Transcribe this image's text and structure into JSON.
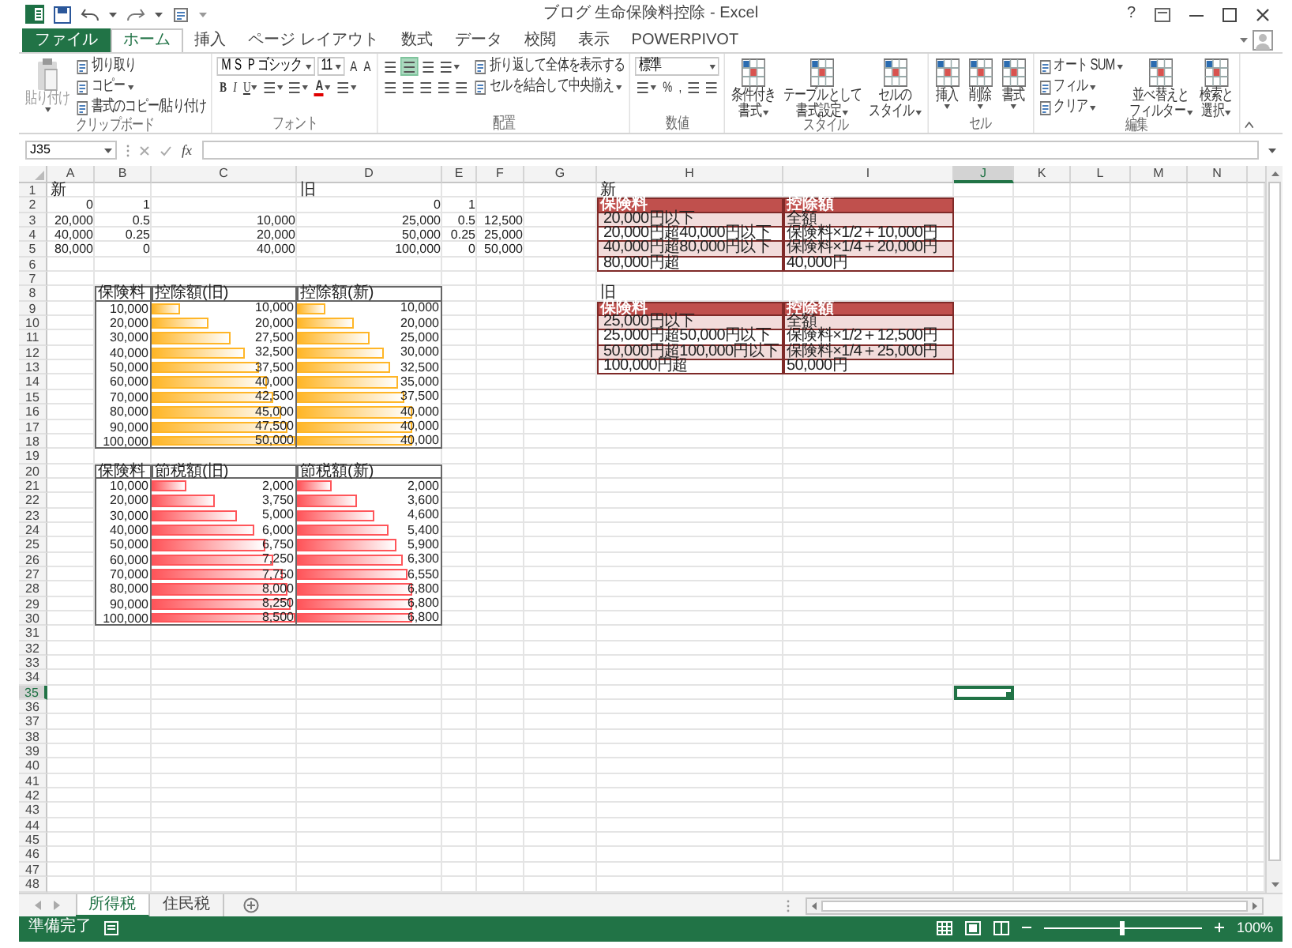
{
  "window": {
    "title": "ブログ 生命保険料控除 - Excel",
    "help": "?"
  },
  "ribbon_tabs": [
    {
      "label": "ファイル",
      "kind": "file",
      "selected": false
    },
    {
      "label": "ホーム",
      "kind": "tab",
      "selected": true
    },
    {
      "label": "挿入",
      "kind": "tab",
      "selected": false
    },
    {
      "label": "ページ レイアウト",
      "kind": "tab",
      "selected": false
    },
    {
      "label": "数式",
      "kind": "tab",
      "selected": false
    },
    {
      "label": "データ",
      "kind": "tab",
      "selected": false
    },
    {
      "label": "校閲",
      "kind": "tab",
      "selected": false
    },
    {
      "label": "表示",
      "kind": "tab",
      "selected": false
    },
    {
      "label": "POWERPIVOT",
      "kind": "tab",
      "selected": false
    }
  ],
  "ribbon_groups": [
    {
      "label": "クリップボード",
      "columns": [
        {
          "kind": "large",
          "lines": [
            "貼り付け"
          ],
          "disabled": true,
          "dropdown": true
        },
        {
          "kind": "stack",
          "rows": [
            {
              "controls": [
                {
                  "kind": "small",
                  "label": "切り取り"
                }
              ]
            },
            {
              "controls": [
                {
                  "kind": "small",
                  "label": "コピー",
                  "dropdown": true
                }
              ]
            },
            {
              "controls": [
                {
                  "kind": "small",
                  "label": "書式のコピー/貼り付け"
                }
              ]
            }
          ]
        }
      ]
    },
    {
      "label": "フォント",
      "columns": [
        {
          "kind": "stack",
          "rows": [
            {
              "controls": [
                {
                  "kind": "combo",
                  "value": "ＭＳ Ｐゴシック"
                },
                {
                  "kind": "combo",
                  "value": "11"
                },
                {
                  "kind": "glyph",
                  "label": "A"
                },
                {
                  "kind": "glyph",
                  "label": "A"
                }
              ]
            },
            {
              "controls": [
                {
                  "kind": "bold",
                  "label": "B"
                },
                {
                  "kind": "italic",
                  "label": "I"
                },
                {
                  "kind": "underline",
                  "label": "U",
                  "dropdown": true
                },
                {
                  "kind": "icon",
                  "dropdown": true
                },
                {
                  "kind": "icon",
                  "dropdown": true
                },
                {
                  "kind": "font_color",
                  "label": "A",
                  "dropdown": true
                },
                {
                  "kind": "icon",
                  "dropdown": true
                }
              ]
            }
          ]
        }
      ]
    },
    {
      "label": "配置",
      "columns": [
        {
          "kind": "stack",
          "rows": [
            {
              "controls": [
                {
                  "kind": "icon",
                  "selected": false
                },
                {
                  "kind": "icon",
                  "selected": true
                },
                {
                  "kind": "icon",
                  "selected": false
                },
                {
                  "kind": "icon",
                  "dropdown": true
                }
              ]
            },
            {
              "controls": [
                {
                  "kind": "icon"
                },
                {
                  "kind": "icon"
                },
                {
                  "kind": "icon"
                },
                {
                  "kind": "icon"
                },
                {
                  "kind": "icon"
                }
              ]
            }
          ]
        },
        {
          "kind": "stack",
          "rows": [
            {
              "controls": [
                {
                  "kind": "small",
                  "label": "折り返して全体を表示する"
                }
              ]
            },
            {
              "controls": [
                {
                  "kind": "small",
                  "label": "セルを結合して中央揃え",
                  "dropdown": true
                }
              ]
            }
          ]
        }
      ]
    },
    {
      "label": "数値",
      "columns": [
        {
          "kind": "stack",
          "rows": [
            {
              "controls": [
                {
                  "kind": "combo",
                  "value": "標準"
                }
              ]
            },
            {
              "controls": [
                {
                  "kind": "icon",
                  "dropdown": true
                },
                {
                  "kind": "glyph",
                  "label": "%"
                },
                {
                  "kind": "glyph",
                  "label": ","
                },
                {
                  "kind": "icon"
                },
                {
                  "kind": "icon"
                }
              ]
            }
          ]
        }
      ]
    },
    {
      "label": "スタイル",
      "columns": [
        {
          "kind": "large",
          "lines": [
            "条件付き",
            "書式"
          ],
          "dropdown": true
        },
        {
          "kind": "large",
          "lines": [
            "テーブルとして",
            "書式設定"
          ],
          "dropdown": true
        },
        {
          "kind": "large",
          "lines": [
            "セルの",
            "スタイル"
          ],
          "dropdown": true
        }
      ]
    },
    {
      "label": "セル",
      "columns": [
        {
          "kind": "large",
          "lines": [
            "挿入"
          ],
          "dropdown": true
        },
        {
          "kind": "large",
          "lines": [
            "削除"
          ],
          "dropdown": true
        },
        {
          "kind": "large",
          "lines": [
            "書式"
          ],
          "dropdown": true
        }
      ]
    },
    {
      "label": "編集",
      "columns": [
        {
          "kind": "stack",
          "rows": [
            {
              "controls": [
                {
                  "kind": "small",
                  "label": "オート SUM",
                  "dropdown": true
                }
              ]
            },
            {
              "controls": [
                {
                  "kind": "small",
                  "label": "フィル",
                  "dropdown": true
                }
              ]
            },
            {
              "controls": [
                {
                  "kind": "small",
                  "label": "クリア",
                  "dropdown": true
                }
              ]
            }
          ]
        },
        {
          "kind": "large",
          "lines": [
            "並べ替えと",
            "フィルター"
          ],
          "dropdown": true
        },
        {
          "kind": "large",
          "lines": [
            "検索と",
            "選択"
          ],
          "dropdown": true
        }
      ]
    }
  ],
  "formula_bar": {
    "name_box": "J35",
    "function_label": "fx"
  },
  "sheet": {
    "columns": [
      {
        "label": "A",
        "selected": false
      },
      {
        "label": "B",
        "selected": false
      },
      {
        "label": "C",
        "selected": false
      },
      {
        "label": "D",
        "selected": false
      },
      {
        "label": "E",
        "selected": false
      },
      {
        "label": "F",
        "selected": false
      },
      {
        "label": "G",
        "selected": false
      },
      {
        "label": "H",
        "selected": false
      },
      {
        "label": "I",
        "selected": false
      },
      {
        "label": "J",
        "selected": true
      },
      {
        "label": "K",
        "selected": false
      },
      {
        "label": "L",
        "selected": false
      },
      {
        "label": "M",
        "selected": false
      },
      {
        "label": "N",
        "selected": false
      }
    ],
    "rows": [
      {
        "header": "1",
        "selected": false,
        "cells": [
          {
            "kind": "text",
            "text": "新"
          },
          null,
          null,
          {
            "kind": "text",
            "text": "旧"
          },
          null,
          null,
          null,
          {
            "kind": "text",
            "text": "新"
          }
        ]
      },
      {
        "header": "2",
        "selected": false,
        "cells": [
          {
            "kind": "number",
            "text": "0"
          },
          {
            "kind": "number",
            "text": "1"
          },
          null,
          {
            "kind": "number",
            "text": "0"
          },
          {
            "kind": "number",
            "text": "1"
          },
          null,
          null,
          {
            "kind": "band_header",
            "text": "保険料"
          },
          {
            "kind": "band_header",
            "text": "控除額"
          }
        ]
      },
      {
        "header": "3",
        "selected": false,
        "cells": [
          {
            "kind": "number",
            "text": "20,000"
          },
          {
            "kind": "number",
            "text": "0.5"
          },
          {
            "kind": "number",
            "text": "10,000"
          },
          {
            "kind": "number",
            "text": "25,000"
          },
          {
            "kind": "number",
            "text": "0.5"
          },
          {
            "kind": "number",
            "text": "12,500"
          },
          null,
          {
            "kind": "band",
            "text": "20,000円以下",
            "shaded": true
          },
          {
            "kind": "band",
            "text": "全額",
            "shaded": true
          }
        ]
      },
      {
        "header": "4",
        "selected": false,
        "cells": [
          {
            "kind": "number",
            "text": "40,000"
          },
          {
            "kind": "number",
            "text": "0.25"
          },
          {
            "kind": "number",
            "text": "20,000"
          },
          {
            "kind": "number",
            "text": "50,000"
          },
          {
            "kind": "number",
            "text": "0.25"
          },
          {
            "kind": "number",
            "text": "25,000"
          },
          null,
          {
            "kind": "band",
            "text": "20,000円超40,000円以下",
            "shaded": false
          },
          {
            "kind": "band",
            "text": "保険料×1/2＋10,000円",
            "shaded": false
          }
        ]
      },
      {
        "header": "5",
        "selected": false,
        "cells": [
          {
            "kind": "number",
            "text": "80,000"
          },
          {
            "kind": "number",
            "text": "0"
          },
          {
            "kind": "number",
            "text": "40,000"
          },
          {
            "kind": "number",
            "text": "100,000"
          },
          {
            "kind": "number",
            "text": "0"
          },
          {
            "kind": "number",
            "text": "50,000"
          },
          null,
          {
            "kind": "band",
            "text": "40,000円超80,000円以下",
            "shaded": true
          },
          {
            "kind": "band",
            "text": "保険料×1/4＋20,000円",
            "shaded": true
          }
        ]
      },
      {
        "header": "6",
        "selected": false,
        "cells": [
          null,
          null,
          null,
          null,
          null,
          null,
          null,
          {
            "kind": "band",
            "text": "80,000円超",
            "shaded": false
          },
          {
            "kind": "band",
            "text": "40,000円",
            "shaded": false
          }
        ]
      },
      {
        "header": "7",
        "selected": false
      },
      {
        "header": "8",
        "selected": false,
        "cells": [
          null,
          {
            "kind": "grid_header",
            "text": "保険料"
          },
          {
            "kind": "grid_header",
            "text": "控除額(旧)"
          },
          {
            "kind": "grid_header",
            "text": "控除額(新)"
          },
          null,
          null,
          null,
          {
            "kind": "text",
            "text": "旧"
          }
        ]
      },
      {
        "header": "9",
        "selected": false,
        "cells": [
          null,
          {
            "kind": "grid_number",
            "text": "10,000"
          },
          {
            "kind": "bar",
            "text": "10,000",
            "level": 0.2,
            "color": "#ffb628"
          },
          {
            "kind": "bar",
            "text": "10,000",
            "level": 0.2,
            "color": "#ffb628"
          },
          null,
          null,
          null,
          {
            "kind": "band_header",
            "text": "保険料"
          },
          {
            "kind": "band_header",
            "text": "控除額"
          }
        ]
      },
      {
        "header": "10",
        "selected": false,
        "cells": [
          null,
          {
            "kind": "grid_number",
            "text": "20,000"
          },
          {
            "kind": "bar",
            "text": "20,000",
            "level": 0.4,
            "color": "#ffb628"
          },
          {
            "kind": "bar",
            "text": "20,000",
            "level": 0.4,
            "color": "#ffb628"
          },
          null,
          null,
          null,
          {
            "kind": "band",
            "text": "25,000円以下",
            "shaded": true
          },
          {
            "kind": "band",
            "text": "全額",
            "shaded": true
          }
        ]
      },
      {
        "header": "11",
        "selected": false,
        "cells": [
          null,
          {
            "kind": "grid_number",
            "text": "30,000"
          },
          {
            "kind": "bar",
            "text": "27,500",
            "level": 0.55,
            "color": "#ffb628"
          },
          {
            "kind": "bar",
            "text": "25,000",
            "level": 0.5,
            "color": "#ffb628"
          },
          null,
          null,
          null,
          {
            "kind": "band",
            "text": "25,000円超50,000円以下",
            "shaded": false
          },
          {
            "kind": "band",
            "text": "保険料×1/2＋12,500円",
            "shaded": false
          }
        ]
      },
      {
        "header": "12",
        "selected": false,
        "cells": [
          null,
          {
            "kind": "grid_number",
            "text": "40,000"
          },
          {
            "kind": "bar",
            "text": "32,500",
            "level": 0.65,
            "color": "#ffb628"
          },
          {
            "kind": "bar",
            "text": "30,000",
            "level": 0.6,
            "color": "#ffb628"
          },
          null,
          null,
          null,
          {
            "kind": "band",
            "text": "50,000円超100,000円以下",
            "shaded": true
          },
          {
            "kind": "band",
            "text": "保険料×1/4＋25,000円",
            "shaded": true
          }
        ]
      },
      {
        "header": "13",
        "selected": false,
        "cells": [
          null,
          {
            "kind": "grid_number",
            "text": "50,000"
          },
          {
            "kind": "bar",
            "text": "37,500",
            "level": 0.75,
            "color": "#ffb628"
          },
          {
            "kind": "bar",
            "text": "32,500",
            "level": 0.65,
            "color": "#ffb628"
          },
          null,
          null,
          null,
          {
            "kind": "band",
            "text": "100,000円超",
            "shaded": false
          },
          {
            "kind": "band",
            "text": "50,000円",
            "shaded": false
          }
        ]
      },
      {
        "header": "14",
        "selected": false,
        "cells": [
          null,
          {
            "kind": "grid_number",
            "text": "60,000"
          },
          {
            "kind": "bar",
            "text": "40,000",
            "level": 0.8,
            "color": "#ffb628"
          },
          {
            "kind": "bar",
            "text": "35,000",
            "level": 0.7,
            "color": "#ffb628"
          }
        ]
      },
      {
        "header": "15",
        "selected": false,
        "cells": [
          null,
          {
            "kind": "grid_number",
            "text": "70,000"
          },
          {
            "kind": "bar",
            "text": "42,500",
            "level": 0.85,
            "color": "#ffb628"
          },
          {
            "kind": "bar",
            "text": "37,500",
            "level": 0.75,
            "color": "#ffb628"
          }
        ]
      },
      {
        "header": "16",
        "selected": false,
        "cells": [
          null,
          {
            "kind": "grid_number",
            "text": "80,000"
          },
          {
            "kind": "bar",
            "text": "45,000",
            "level": 0.9,
            "color": "#ffb628"
          },
          {
            "kind": "bar",
            "text": "40,000",
            "level": 0.8,
            "color": "#ffb628"
          }
        ]
      },
      {
        "header": "17",
        "selected": false,
        "cells": [
          null,
          {
            "kind": "grid_number",
            "text": "90,000"
          },
          {
            "kind": "bar",
            "text": "47,500",
            "level": 0.95,
            "color": "#ffb628"
          },
          {
            "kind": "bar",
            "text": "40,000",
            "level": 0.8,
            "color": "#ffb628"
          }
        ]
      },
      {
        "header": "18",
        "selected": false,
        "cells": [
          null,
          {
            "kind": "grid_number",
            "text": "100,000"
          },
          {
            "kind": "bar",
            "text": "50,000",
            "level": 1,
            "color": "#ffb628"
          },
          {
            "kind": "bar",
            "text": "40,000",
            "level": 0.8,
            "color": "#ffb628"
          }
        ]
      },
      {
        "header": "19",
        "selected": false
      },
      {
        "header": "20",
        "selected": false,
        "cells": [
          null,
          {
            "kind": "grid_header",
            "text": "保険料"
          },
          {
            "kind": "grid_header",
            "text": "節税額(旧)"
          },
          {
            "kind": "grid_header",
            "text": "節税額(新)"
          }
        ]
      },
      {
        "header": "21",
        "selected": false,
        "cells": [
          null,
          {
            "kind": "grid_number",
            "text": "10,000"
          },
          {
            "kind": "bar",
            "text": "2,000",
            "level": 0.24,
            "color": "#ff555a"
          },
          {
            "kind": "bar",
            "text": "2,000",
            "level": 0.24,
            "color": "#ff555a"
          }
        ]
      },
      {
        "header": "22",
        "selected": false,
        "cells": [
          null,
          {
            "kind": "grid_number",
            "text": "20,000"
          },
          {
            "kind": "bar",
            "text": "3,750",
            "level": 0.44,
            "color": "#ff555a"
          },
          {
            "kind": "bar",
            "text": "3,600",
            "level": 0.42,
            "color": "#ff555a"
          }
        ]
      },
      {
        "header": "23",
        "selected": false,
        "cells": [
          null,
          {
            "kind": "grid_number",
            "text": "30,000"
          },
          {
            "kind": "bar",
            "text": "5,000",
            "level": 0.59,
            "color": "#ff555a"
          },
          {
            "kind": "bar",
            "text": "4,600",
            "level": 0.54,
            "color": "#ff555a"
          }
        ]
      },
      {
        "header": "24",
        "selected": false,
        "cells": [
          null,
          {
            "kind": "grid_number",
            "text": "40,000"
          },
          {
            "kind": "bar",
            "text": "6,000",
            "level": 0.71,
            "color": "#ff555a"
          },
          {
            "kind": "bar",
            "text": "5,400",
            "level": 0.64,
            "color": "#ff555a"
          }
        ]
      },
      {
        "header": "25",
        "selected": false,
        "cells": [
          null,
          {
            "kind": "grid_number",
            "text": "50,000"
          },
          {
            "kind": "bar",
            "text": "6,750",
            "level": 0.79,
            "color": "#ff555a"
          },
          {
            "kind": "bar",
            "text": "5,900",
            "level": 0.69,
            "color": "#ff555a"
          }
        ]
      },
      {
        "header": "26",
        "selected": false,
        "cells": [
          null,
          {
            "kind": "grid_number",
            "text": "60,000"
          },
          {
            "kind": "bar",
            "text": "7,250",
            "level": 0.85,
            "color": "#ff555a"
          },
          {
            "kind": "bar",
            "text": "6,300",
            "level": 0.74,
            "color": "#ff555a"
          }
        ]
      },
      {
        "header": "27",
        "selected": false,
        "cells": [
          null,
          {
            "kind": "grid_number",
            "text": "70,000"
          },
          {
            "kind": "bar",
            "text": "7,750",
            "level": 0.91,
            "color": "#ff555a"
          },
          {
            "kind": "bar",
            "text": "6,550",
            "level": 0.77,
            "color": "#ff555a"
          }
        ]
      },
      {
        "header": "28",
        "selected": false,
        "cells": [
          null,
          {
            "kind": "grid_number",
            "text": "80,000"
          },
          {
            "kind": "bar",
            "text": "8,000",
            "level": 0.94,
            "color": "#ff555a"
          },
          {
            "kind": "bar",
            "text": "6,800",
            "level": 0.8,
            "color": "#ff555a"
          }
        ]
      },
      {
        "header": "29",
        "selected": false,
        "cells": [
          null,
          {
            "kind": "grid_number",
            "text": "90,000"
          },
          {
            "kind": "bar",
            "text": "8,250",
            "level": 0.97,
            "color": "#ff555a"
          },
          {
            "kind": "bar",
            "text": "6,800",
            "level": 0.8,
            "color": "#ff555a"
          }
        ]
      },
      {
        "header": "30",
        "selected": false,
        "cells": [
          null,
          {
            "kind": "grid_number",
            "text": "100,000"
          },
          {
            "kind": "bar",
            "text": "8,500",
            "level": 1,
            "color": "#ff555a"
          },
          {
            "kind": "bar",
            "text": "6,800",
            "level": 0.8,
            "color": "#ff555a"
          }
        ]
      },
      {
        "header": "31",
        "selected": false
      },
      {
        "header": "32",
        "selected": false
      },
      {
        "header": "33",
        "selected": false
      },
      {
        "header": "34",
        "selected": false
      },
      {
        "header": "35",
        "selected": true
      },
      {
        "header": "36",
        "selected": false
      },
      {
        "header": "37",
        "selected": false
      },
      {
        "header": "38",
        "selected": false
      },
      {
        "header": "39",
        "selected": false
      },
      {
        "header": "40",
        "selected": false
      },
      {
        "header": "41",
        "selected": false
      },
      {
        "header": "42",
        "selected": false
      },
      {
        "header": "43",
        "selected": false
      },
      {
        "header": "44",
        "selected": false
      },
      {
        "header": "45",
        "selected": false
      },
      {
        "header": "46",
        "selected": false
      },
      {
        "header": "47",
        "selected": false
      },
      {
        "header": "48",
        "selected": false
      }
    ]
  },
  "sheet_tabs": [
    {
      "label": "所得税",
      "selected": true
    },
    {
      "label": "住民税",
      "selected": false
    }
  ],
  "status_bar": {
    "status": "準備完了",
    "zoom": "100%",
    "zoom_level": {
      "level": 0.5
    }
  }
}
